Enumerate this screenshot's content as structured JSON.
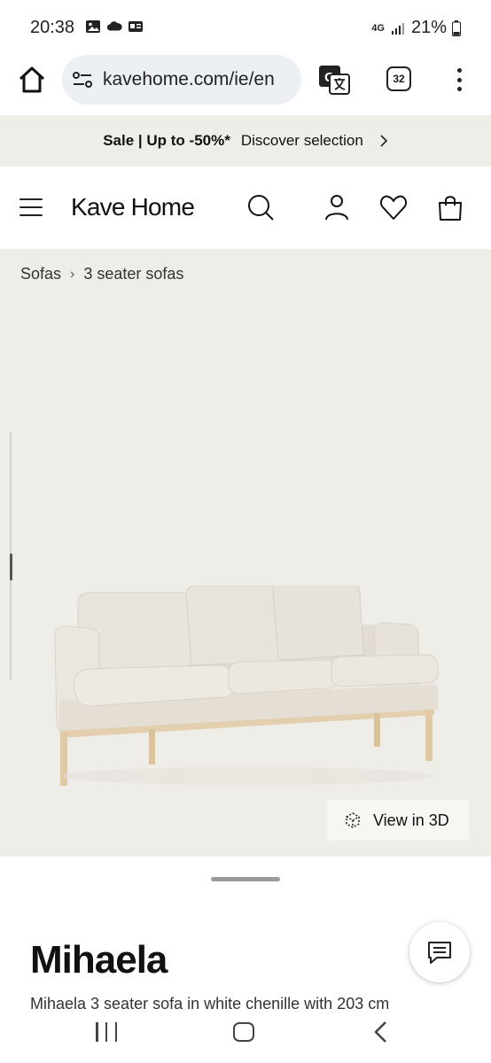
{
  "status_bar": {
    "time": "20:38",
    "network": "4G",
    "battery": "21%",
    "icons": [
      "gallery-icon",
      "cloud-icon",
      "news-icon",
      "signal-icon",
      "battery-icon"
    ]
  },
  "browser": {
    "url": "kavehome.com/ie/en",
    "tab_count": "32",
    "icons": [
      "home-icon",
      "tune-icon",
      "translate-icon",
      "more-vert-icon"
    ]
  },
  "promo": {
    "bold_text": "Sale | Up to -50%*",
    "link_text": "Discover selection"
  },
  "header": {
    "logo": "Kave Home",
    "icons": [
      "menu-icon",
      "search-icon",
      "account-icon",
      "wishlist-icon",
      "bag-icon"
    ]
  },
  "breadcrumb": {
    "items": [
      "Sofas",
      "3 seater sofas"
    ]
  },
  "product": {
    "view_3d_label": "View in 3D",
    "name": "Mihaela",
    "subtitle": "Mihaela 3 seater sofa in white chenille with 203 cm"
  },
  "colors": {
    "page_bg": "#efede8",
    "sofa_fabric": "#e6e0d8",
    "sofa_wood": "#e3cfae",
    "text": "#111111"
  }
}
